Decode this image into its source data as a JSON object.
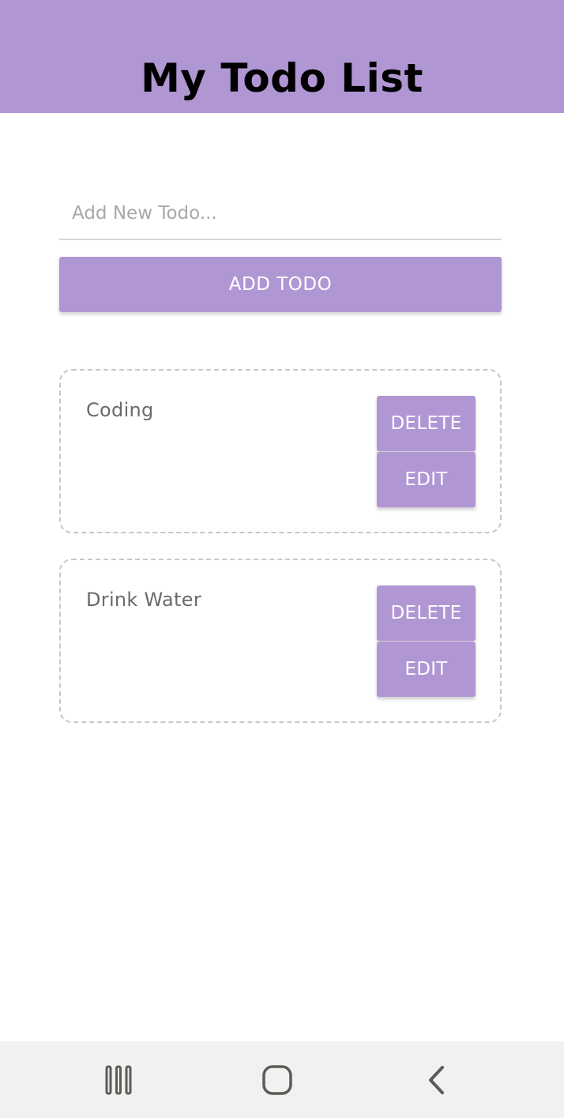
{
  "header": {
    "title": "My Todo List"
  },
  "new_todo": {
    "value": "",
    "placeholder": "Add New Todo..."
  },
  "add_button_label": "ADD TODO",
  "todos": [
    {
      "text": "Coding",
      "delete_label": "DELETE",
      "edit_label": "EDIT"
    },
    {
      "text": "Drink Water",
      "delete_label": "DELETE",
      "edit_label": "EDIT"
    }
  ],
  "navbar": {
    "recents_icon": "recents-icon",
    "home_icon": "home-icon",
    "back_icon": "back-icon"
  },
  "colors": {
    "accent": "#b196d4",
    "header_text": "#000000",
    "button_text": "#ffffff",
    "todo_text": "#6a6a6a",
    "card_border": "#c8c8c8",
    "navbar_bg": "#f1f1f1"
  }
}
